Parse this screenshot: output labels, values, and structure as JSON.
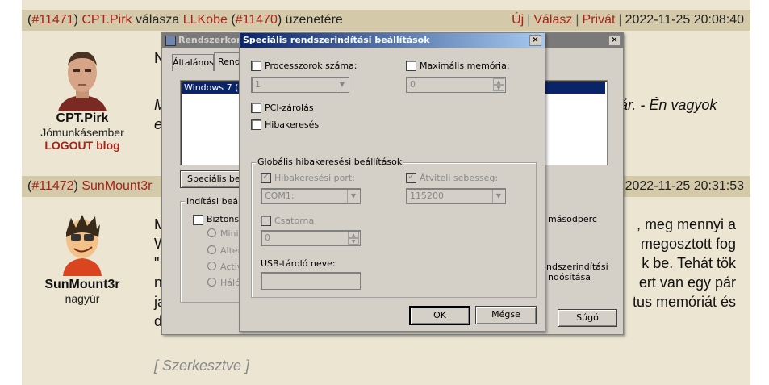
{
  "post1": {
    "header": {
      "open_paren": "(",
      "id": "#11471",
      "close_paren": ")",
      "author": "CPT.Pirk",
      "replies_to_text": "válasza",
      "target": "LLKobe",
      "target_id": "#11470",
      "suffix": "üzenetére",
      "new": "Új",
      "reply": "Válasz",
      "private": "Privát",
      "datetime": "2022-11-25 20:08:40"
    },
    "author": {
      "name": "CPT.Pirk",
      "rank": "Jómunkásember",
      "blog": "LOGOUT blog"
    },
    "text_lines": [
      "N",
      "M",
      "e"
    ],
    "right_text": "ár. - Én vagyok"
  },
  "post2": {
    "header": {
      "open_paren": "(",
      "id": "#11472",
      "close_paren": ")",
      "author": "SunMount3r",
      "datetime": "2022-11-25 20:31:53"
    },
    "author": {
      "name": "SunMount3r",
      "rank": "nagyúr"
    },
    "left_lines": [
      "M",
      "W",
      "\"",
      "n",
      "ja",
      "d"
    ],
    "right_lines": [
      ", meg mennyi a",
      "megosztott fog",
      "k be. Tehát tök",
      "ert van egy pár",
      "tus memóriát és"
    ],
    "edited": "[ Szerkesztve ]"
  },
  "back_window": {
    "title": "Rendszerkon",
    "tabs": [
      "Általános",
      "Rend"
    ],
    "list_item": "Windows 7 (C:",
    "special_button": "Speciális beá",
    "boot_group": "Indítási beállí",
    "safe_boot": "Biztonsá",
    "radios": [
      "Minim",
      "Alter",
      "Active",
      "Hálóz"
    ],
    "right_text1": "másodperc",
    "right_text2": "ndszerindítási",
    "right_text3": "ndósítása",
    "help_button": "Súgó"
  },
  "dialog": {
    "title": "Speciális rendszerindítási beállítások",
    "close": "×",
    "processors_label": "Processzorok száma:",
    "processors_value": "1",
    "max_memory_label": "Maximális memória:",
    "max_memory_value": "0",
    "pci_lock": "PCI-zárolás",
    "debugging": "Hibakeresés",
    "global_debug_group": "Globális hibakeresési beállítások",
    "debug_port_label": "Hibakeresési port:",
    "debug_port_value": "COM1:",
    "baud_rate_label": "Átviteli sebesség:",
    "baud_rate_value": "115200",
    "channel_label": "Csatorna",
    "channel_value": "0",
    "usb_target_label": "USB-tároló neve:",
    "usb_target_value": "",
    "ok_button": "OK",
    "cancel_button": "Mégse"
  },
  "colors": {
    "accent_red": "#a6231a",
    "forum_bg": "#ebe5d1",
    "header_bg": "#d4caa9",
    "titlebar": "#0a246a"
  }
}
